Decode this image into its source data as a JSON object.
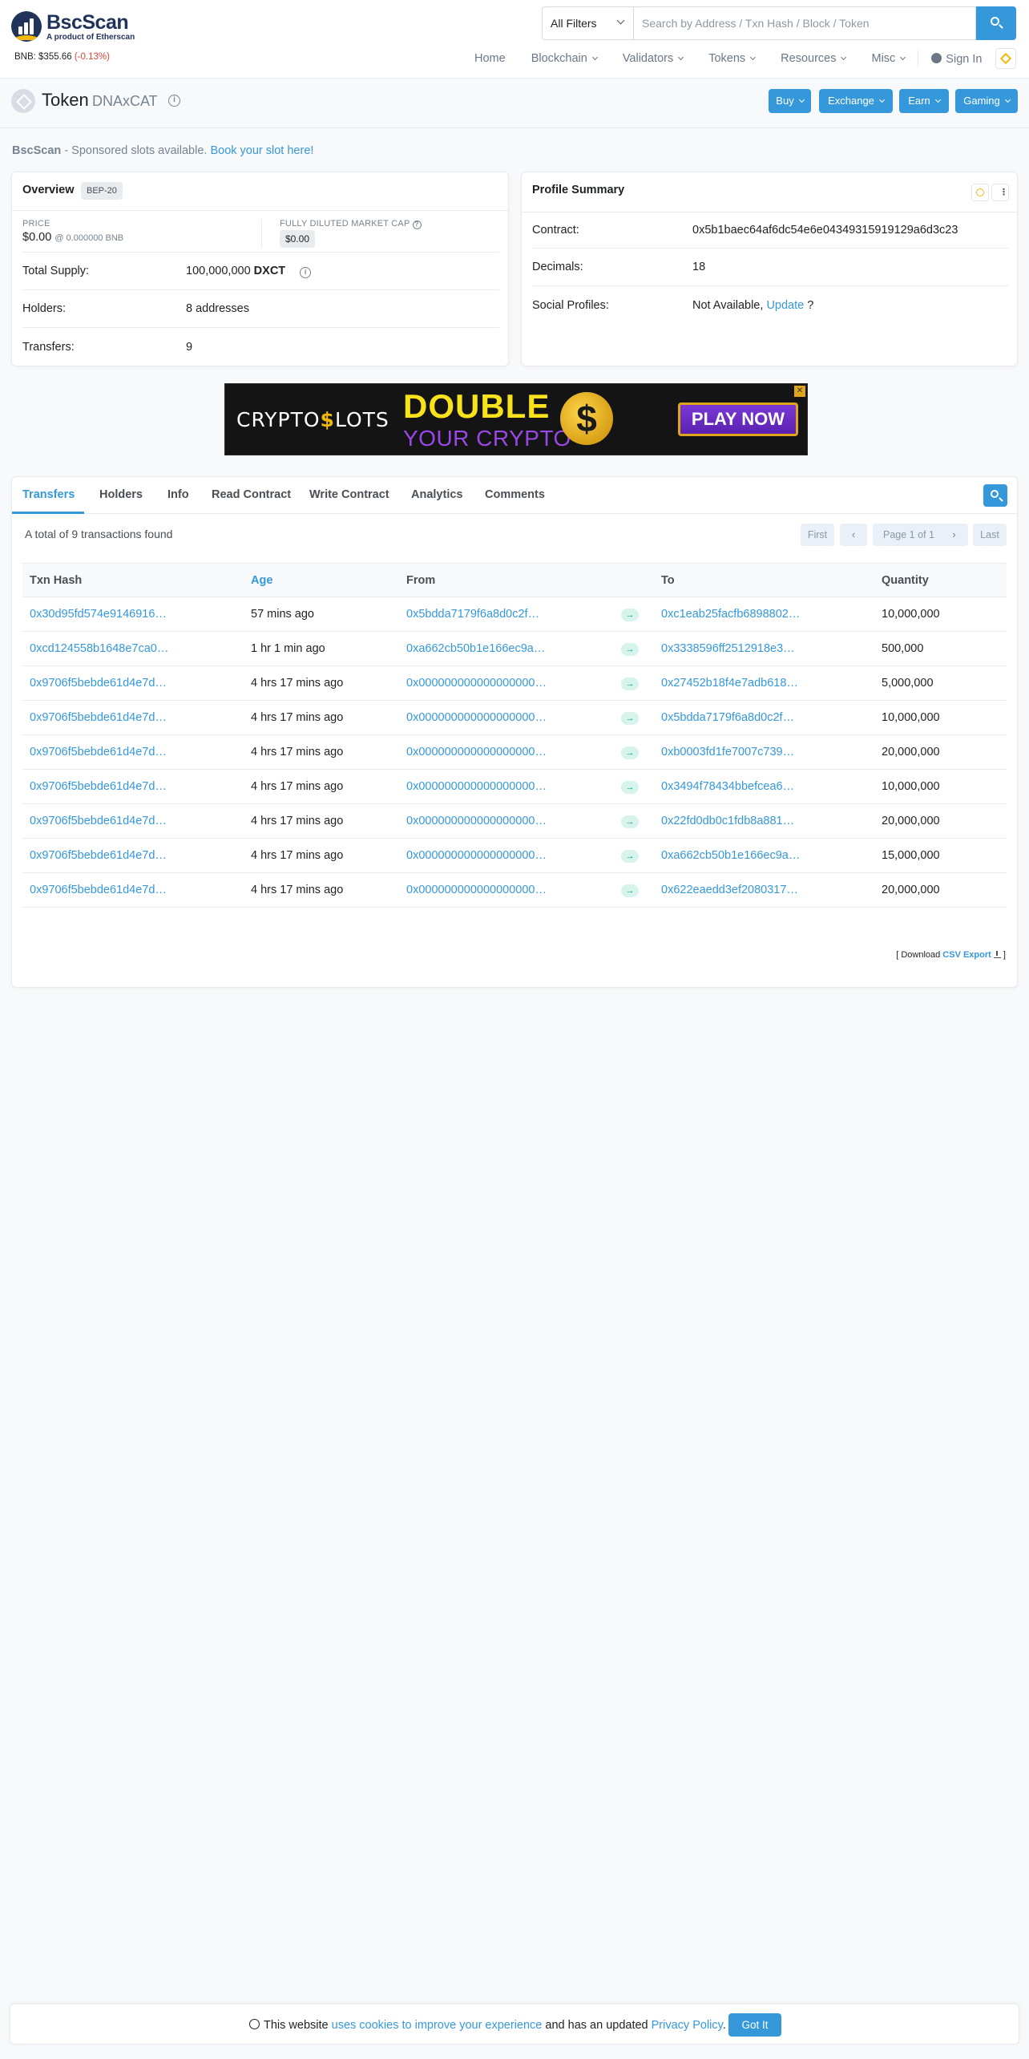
{
  "brand": {
    "name": "BscScan",
    "tagline": "A product of Etherscan"
  },
  "price": {
    "label": "BNB: $355.66",
    "change": "(-0.13%)"
  },
  "search": {
    "filter": "All Filters",
    "placeholder": "Search by Address / Txn Hash / Block / Token"
  },
  "nav": {
    "items": [
      "Home",
      "Blockchain",
      "Validators",
      "Tokens",
      "Resources",
      "Misc"
    ],
    "sign_in": "Sign In"
  },
  "page": {
    "title": "Token",
    "token_name": "DNAxCAT",
    "actions": [
      "Buy",
      "Exchange",
      "Earn",
      "Gaming"
    ]
  },
  "sponsor": {
    "brand": "BscScan",
    "text": " - Sponsored slots available. ",
    "link": "Book your slot here!"
  },
  "overview": {
    "title": "Overview",
    "badge": "BEP-20",
    "price_label": "PRICE",
    "price_value": "$0.00",
    "price_bnb": "@ 0.000000 BNB",
    "mcap_label": "FULLY DILUTED MARKET CAP",
    "mcap_value": "$0.00",
    "total_supply_label": "Total Supply:",
    "total_supply_value": "100,000,000",
    "total_supply_symbol": "DXCT",
    "holders_label": "Holders:",
    "holders_value": "8 addresses",
    "transfers_label": "Transfers:",
    "transfers_value": "9"
  },
  "profile": {
    "title": "Profile Summary",
    "contract_label": "Contract:",
    "contract_value": "0x5b1baec64af6dc54e6e04349315919129a6d3c23",
    "decimals_label": "Decimals:",
    "decimals_value": "18",
    "social_label": "Social Profiles:",
    "social_value": "Not Available, ",
    "social_link": "Update",
    "social_suffix": " ?"
  },
  "ad": {
    "brand_left": "CRYPTO",
    "brand_mid": "$",
    "brand_right": "LOTS",
    "line1": "DOUBLE",
    "line2": "YOUR CRYPTO",
    "coin": "$",
    "cta": "PLAY NOW"
  },
  "tabs": {
    "items": [
      "Transfers",
      "Holders",
      "Info",
      "Read Contract",
      "Write Contract",
      "Analytics",
      "Comments"
    ],
    "total_text": "A total of 9 transactions found",
    "pager": {
      "first": "First",
      "prev": "‹",
      "page": "Page 1 of 1",
      "next": "›",
      "last": "Last"
    }
  },
  "table": {
    "headers": [
      "Txn Hash",
      "Age",
      "From",
      "",
      "To",
      "Quantity"
    ],
    "rows": [
      {
        "hash": "0x30d95fd574e9146916…",
        "age": "57 mins ago",
        "from": "0x5bdda7179f6a8d0c2f…",
        "to": "0xc1eab25facfb6898802…",
        "qty": "10,000,000"
      },
      {
        "hash": "0xcd124558b1648e7ca0…",
        "age": "1 hr 1 min ago",
        "from": "0xa662cb50b1e166ec9a…",
        "to": "0x3338596ff2512918e3…",
        "qty": "500,000"
      },
      {
        "hash": "0x9706f5bebde61d4e7d…",
        "age": "4 hrs 17 mins ago",
        "from": "0x000000000000000000…",
        "to": "0x27452b18f4e7adb618…",
        "qty": "5,000,000"
      },
      {
        "hash": "0x9706f5bebde61d4e7d…",
        "age": "4 hrs 17 mins ago",
        "from": "0x000000000000000000…",
        "to": "0x5bdda7179f6a8d0c2f…",
        "qty": "10,000,000"
      },
      {
        "hash": "0x9706f5bebde61d4e7d…",
        "age": "4 hrs 17 mins ago",
        "from": "0x000000000000000000…",
        "to": "0xb0003fd1fe7007c739…",
        "qty": "20,000,000"
      },
      {
        "hash": "0x9706f5bebde61d4e7d…",
        "age": "4 hrs 17 mins ago",
        "from": "0x000000000000000000…",
        "to": "0x3494f78434bbefcea6…",
        "qty": "10,000,000"
      },
      {
        "hash": "0x9706f5bebde61d4e7d…",
        "age": "4 hrs 17 mins ago",
        "from": "0x000000000000000000…",
        "to": "0x22fd0db0c1fdb8a881…",
        "qty": "20,000,000"
      },
      {
        "hash": "0x9706f5bebde61d4e7d…",
        "age": "4 hrs 17 mins ago",
        "from": "0x000000000000000000…",
        "to": "0xa662cb50b1e166ec9a…",
        "qty": "15,000,000"
      },
      {
        "hash": "0x9706f5bebde61d4e7d…",
        "age": "4 hrs 17 mins ago",
        "from": "0x000000000000000000…",
        "to": "0x622eaedd3ef2080317…",
        "qty": "20,000,000"
      }
    ],
    "arrow": "→"
  },
  "csv": {
    "prefix": "[ Download ",
    "link": "CSV Export",
    "suffix": " ]"
  },
  "cookie": {
    "text1": "This website ",
    "link1": "uses cookies to improve your experience",
    "text2": " and has an updated ",
    "link2": "Privacy Policy",
    "text3": ".",
    "button": "Got It"
  },
  "colors": {
    "primary": "#3498db",
    "negative": "#de4437",
    "arrow_bg": "#d7f4ec",
    "bnb": "#f0b90b"
  }
}
